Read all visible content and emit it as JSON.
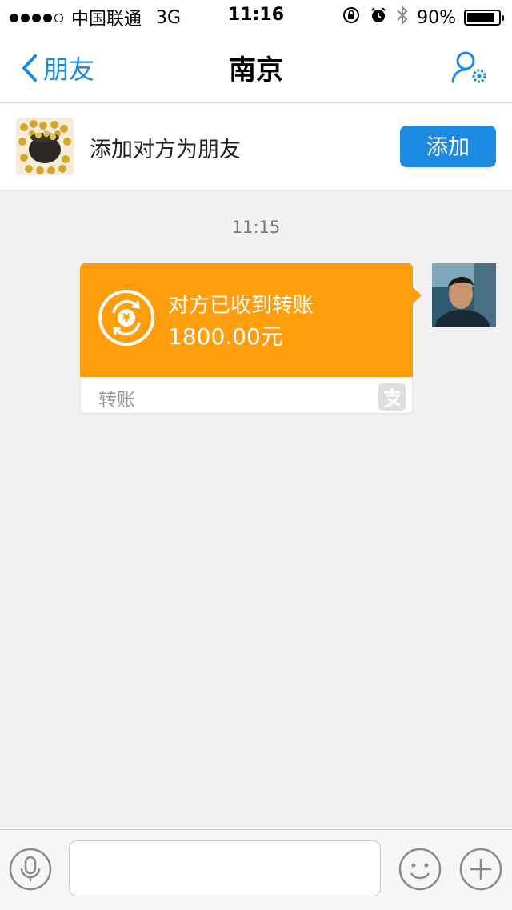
{
  "status_bar": {
    "carrier": "中国联通",
    "network": "3G",
    "time": "11:16",
    "battery": "90%",
    "battery_level": 0.9
  },
  "nav": {
    "back_label": "朋友",
    "title": "南京"
  },
  "add_friend": {
    "prompt": "添加对方为朋友",
    "button": "添加"
  },
  "chat": {
    "timestamp": "11:15",
    "transfer": {
      "status": "对方已收到转账",
      "amount": "1800.00元",
      "footer_label": "转账"
    }
  },
  "input": {
    "placeholder": ""
  },
  "colors": {
    "accent": "#1b8ae0",
    "transfer_orange": "#ff9d0a"
  }
}
